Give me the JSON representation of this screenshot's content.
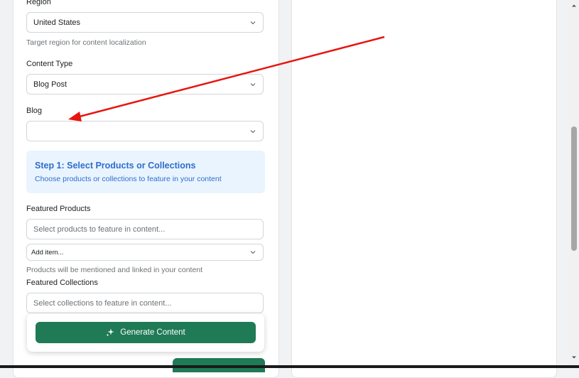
{
  "form": {
    "region": {
      "label": "Region",
      "value": "United States",
      "help": "Target region for content localization"
    },
    "content_type": {
      "label": "Content Type",
      "value": "Blog Post"
    },
    "blog": {
      "label": "Blog",
      "value": ""
    },
    "step1": {
      "title": "Step 1: Select Products or Collections",
      "subtitle": "Choose products or collections to feature in your content"
    },
    "featured_products": {
      "label": "Featured Products",
      "placeholder": "Select products to feature in content...",
      "add_item": "Add item...",
      "help": "Products will be mentioned and linked in your content"
    },
    "featured_collections": {
      "label": "Featured Collections",
      "placeholder": "Select collections to feature in content..."
    },
    "generate_button": "Generate Content"
  },
  "colors": {
    "accent_green": "#1f7a56",
    "callout_bg": "#eaf4ff",
    "callout_text": "#2c6ecb",
    "annotation_arrow": "#e8140e"
  }
}
